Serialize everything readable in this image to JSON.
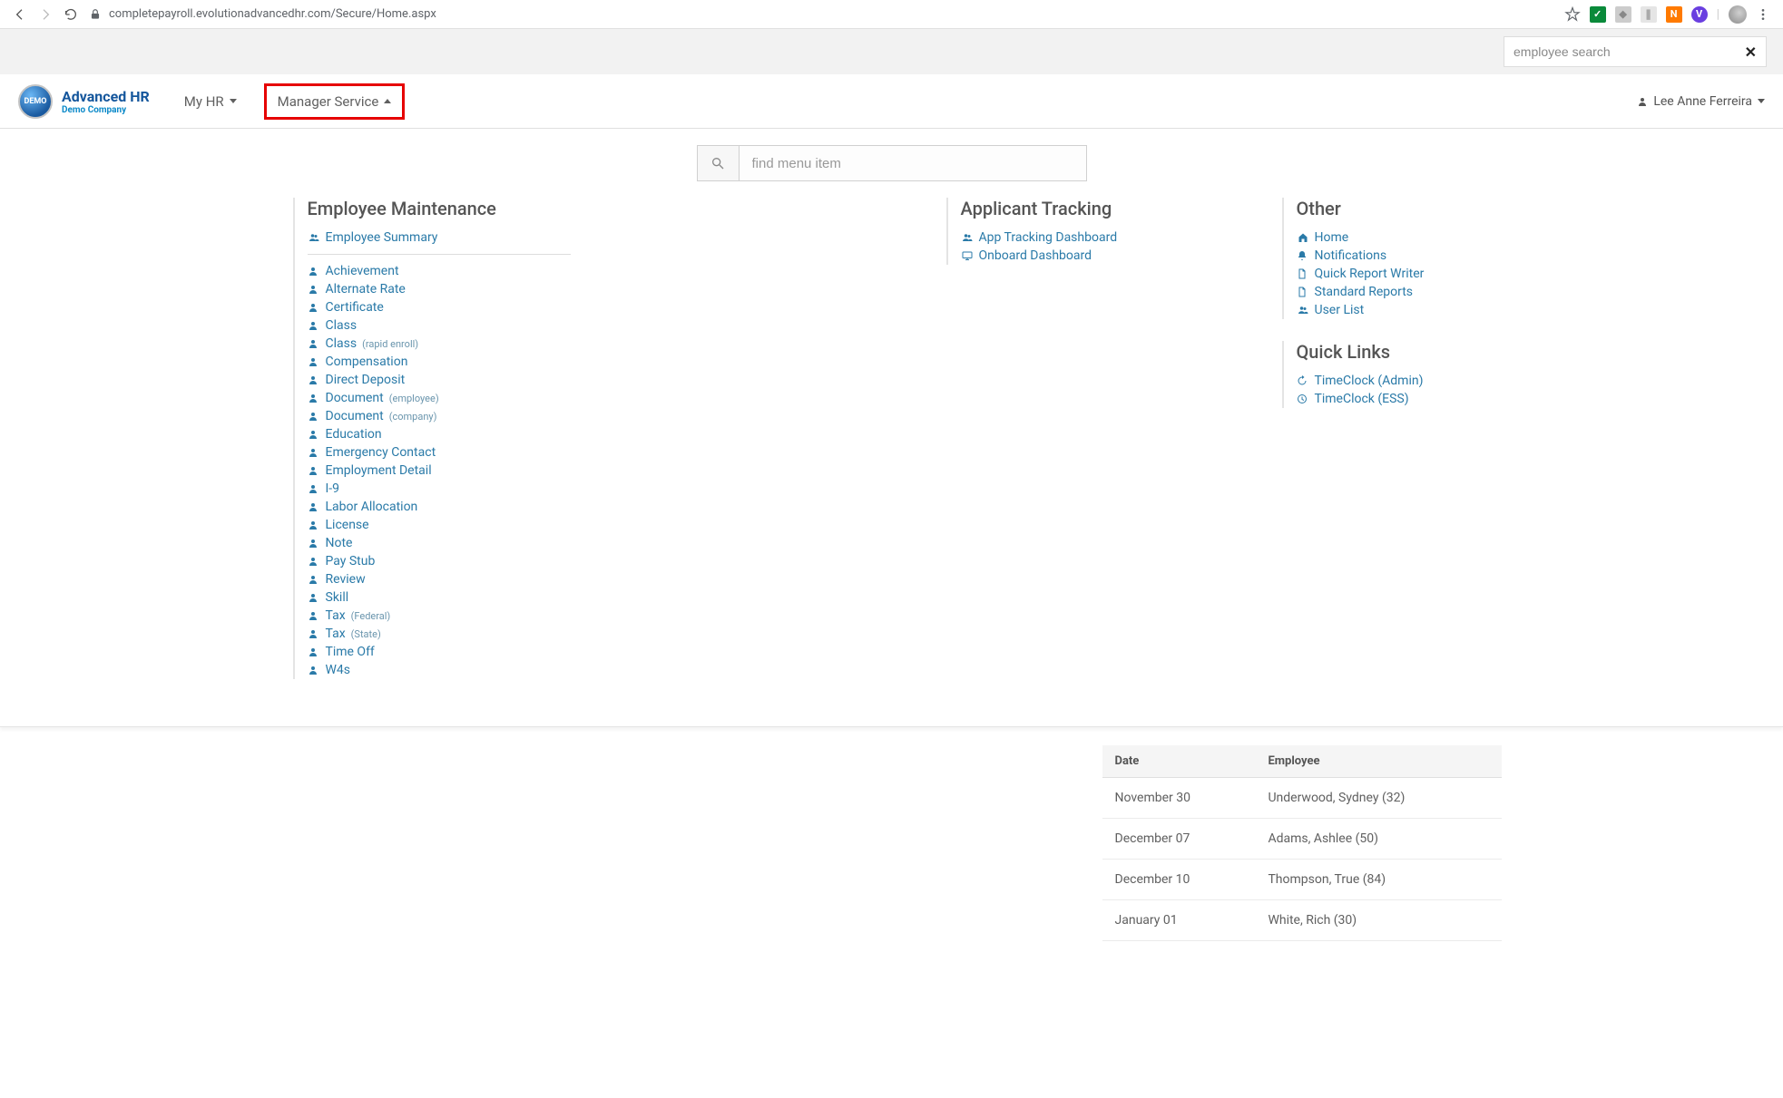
{
  "browser": {
    "url": "completepayroll.evolutionadvancedhr.com/Secure/Home.aspx"
  },
  "search": {
    "employee_placeholder": "employee search",
    "menu_placeholder": "find menu item"
  },
  "brand": {
    "title": "Advanced HR",
    "subtitle": "Demo Company",
    "logo_text": "DEMO"
  },
  "nav": {
    "my_hr": "My HR",
    "manager_service": "Manager Service",
    "user": "Lee Anne Ferreira"
  },
  "sections": {
    "employee_maintenance": {
      "title": "Employee Maintenance",
      "featured": {
        "label": "Employee Summary",
        "icon": "users"
      },
      "items": [
        {
          "label": "Achievement",
          "sub": "",
          "icon": "user"
        },
        {
          "label": "Alternate Rate",
          "sub": "",
          "icon": "user"
        },
        {
          "label": "Certificate",
          "sub": "",
          "icon": "user"
        },
        {
          "label": "Class",
          "sub": "",
          "icon": "user"
        },
        {
          "label": "Class",
          "sub": "(rapid enroll)",
          "icon": "user"
        },
        {
          "label": "Compensation",
          "sub": "",
          "icon": "user"
        },
        {
          "label": "Direct Deposit",
          "sub": "",
          "icon": "user"
        },
        {
          "label": "Document",
          "sub": "(employee)",
          "icon": "user"
        },
        {
          "label": "Document",
          "sub": "(company)",
          "icon": "user"
        },
        {
          "label": "Education",
          "sub": "",
          "icon": "user"
        },
        {
          "label": "Emergency Contact",
          "sub": "",
          "icon": "user"
        },
        {
          "label": "Employment Detail",
          "sub": "",
          "icon": "user"
        },
        {
          "label": "I-9",
          "sub": "",
          "icon": "user"
        },
        {
          "label": "Labor Allocation",
          "sub": "",
          "icon": "user"
        },
        {
          "label": "License",
          "sub": "",
          "icon": "user"
        },
        {
          "label": "Note",
          "sub": "",
          "icon": "user"
        },
        {
          "label": "Pay Stub",
          "sub": "",
          "icon": "user"
        },
        {
          "label": "Review",
          "sub": "",
          "icon": "user"
        },
        {
          "label": "Skill",
          "sub": "",
          "icon": "user"
        },
        {
          "label": "Tax",
          "sub": "(Federal)",
          "icon": "user"
        },
        {
          "label": "Tax",
          "sub": "(State)",
          "icon": "user"
        },
        {
          "label": "Time Off",
          "sub": "",
          "icon": "user"
        },
        {
          "label": "W4s",
          "sub": "",
          "icon": "user"
        }
      ]
    },
    "applicant_tracking": {
      "title": "Applicant Tracking",
      "items": [
        {
          "label": "App Tracking Dashboard",
          "icon": "users"
        },
        {
          "label": "Onboard Dashboard",
          "icon": "monitor"
        }
      ]
    },
    "other": {
      "title": "Other",
      "items": [
        {
          "label": "Home",
          "icon": "home"
        },
        {
          "label": "Notifications",
          "icon": "bell"
        },
        {
          "label": "Quick Report Writer",
          "icon": "file"
        },
        {
          "label": "Standard Reports",
          "icon": "file"
        },
        {
          "label": "User List",
          "icon": "users"
        }
      ]
    },
    "quick_links": {
      "title": "Quick Links",
      "items": [
        {
          "label": "TimeClock (Admin)",
          "icon": "back"
        },
        {
          "label": "TimeClock (ESS)",
          "icon": "clock"
        }
      ]
    }
  },
  "table": {
    "columns": [
      "Date",
      "Employee"
    ],
    "rows": [
      {
        "date": "November 30",
        "employee": "Underwood, Sydney (32)"
      },
      {
        "date": "December 07",
        "employee": "Adams, Ashlee (50)"
      },
      {
        "date": "December 10",
        "employee": "Thompson, True (84)"
      },
      {
        "date": "January 01",
        "employee": "White, Rich (30)"
      }
    ]
  }
}
